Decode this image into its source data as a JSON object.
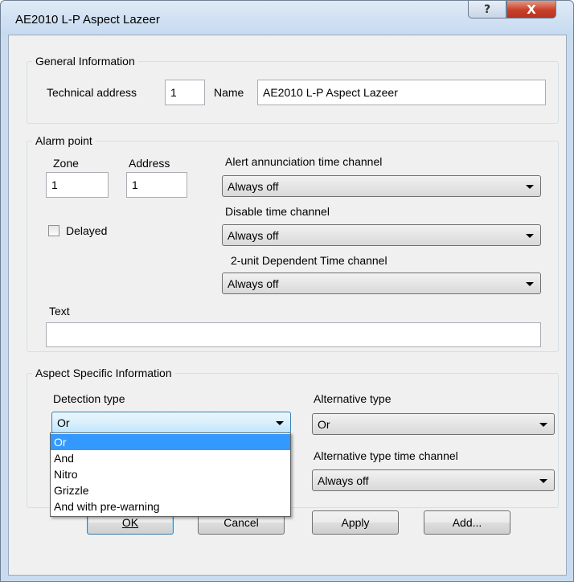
{
  "window": {
    "title": "AE2010 L-P Aspect Lazeer",
    "help_glyph": "?",
    "close_glyph": "X"
  },
  "general": {
    "legend": "General Information",
    "tech_address_label": "Technical address",
    "tech_address_value": "1",
    "name_label": "Name",
    "name_value": "AE2010 L-P Aspect Lazeer"
  },
  "alarm": {
    "legend": "Alarm point",
    "zone_label": "Zone",
    "zone_value": "1",
    "address_label": "Address",
    "address_value": "1",
    "delayed_label": "Delayed",
    "delayed_checked": false,
    "alert_channel_label": "Alert annunciation time channel",
    "alert_channel_value": "Always off",
    "disable_channel_label": "Disable time channel",
    "disable_channel_value": "Always off",
    "dependent_channel_label": "2-unit Dependent Time channel",
    "dependent_channel_value": "Always off",
    "text_label": "Text",
    "text_value": ""
  },
  "aspect": {
    "legend": "Aspect Specific Information",
    "detection_type_label": "Detection type",
    "detection_type_value": "Or",
    "detection_type_options": [
      "Or",
      "And",
      "Nitro",
      "Grizzle",
      "And with pre-warning"
    ],
    "detection_type_selected_index": 0,
    "alternative_type_label": "Alternative type",
    "alternative_type_value": "Or",
    "alternative_channel_label": "Alternative type time channel",
    "alternative_channel_value": "Always off"
  },
  "buttons": {
    "ok": "OK",
    "cancel": "Cancel",
    "apply": "Apply",
    "add": "Add..."
  }
}
